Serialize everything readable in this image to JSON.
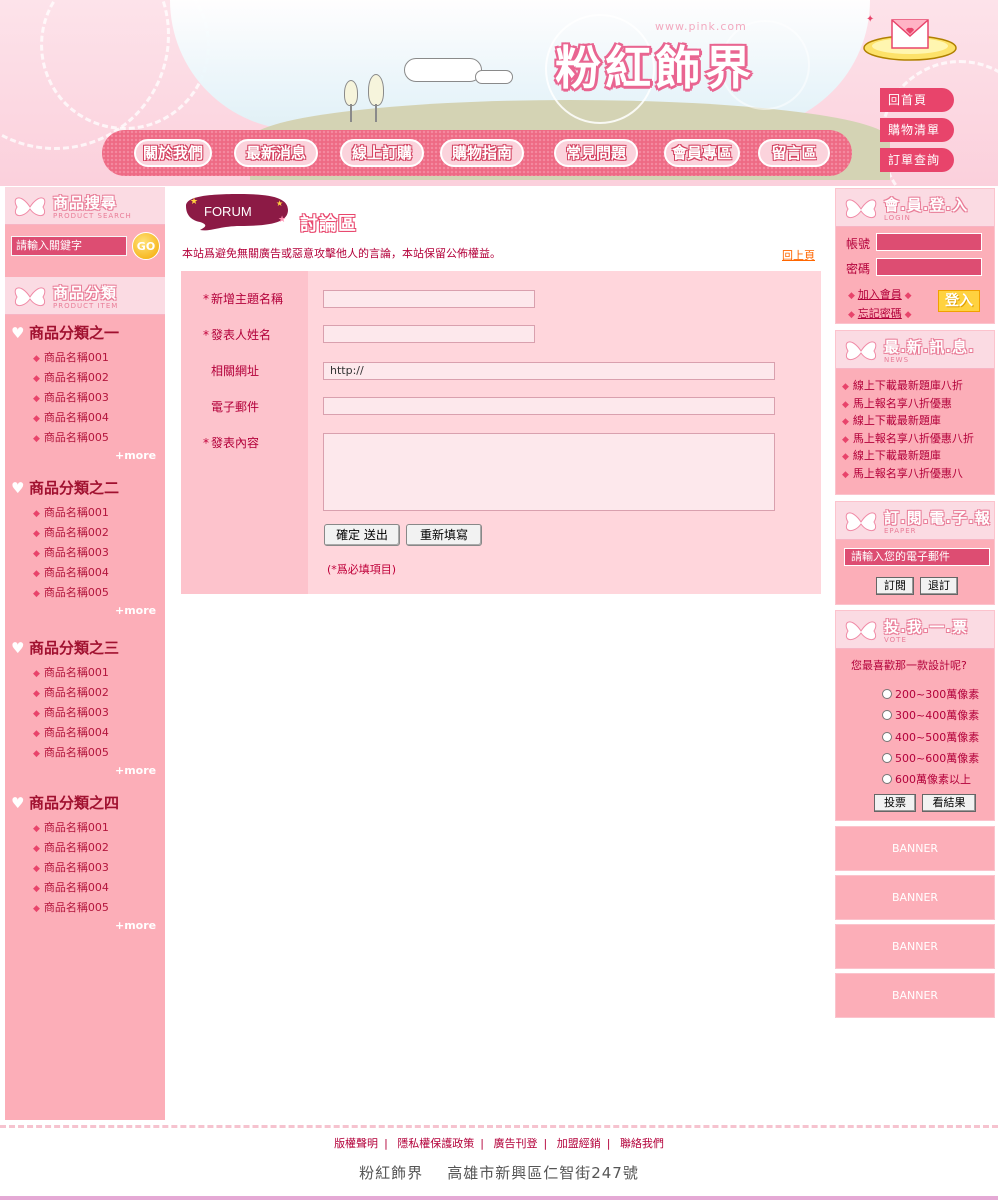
{
  "header": {
    "site_url": "www.pink.com",
    "site_name": "粉紅飾界",
    "nav": [
      "關於我們",
      "最新消息",
      "線上訂購",
      "購物指南",
      "常見問題",
      "會員專區",
      "留言區"
    ],
    "side_links": [
      "回首頁",
      "購物清單",
      "訂單查詢"
    ]
  },
  "left": {
    "search": {
      "title": "商品搜尋",
      "subtitle": "PRODUCT SEARCH",
      "placeholder": "請輸入關鍵字",
      "go": "GO"
    },
    "categories": {
      "title": "商品分類",
      "subtitle": "PRODUCT ITEM",
      "more": "+more",
      "groups": [
        {
          "name": "商品分類之一",
          "items": [
            "商品名稱001",
            "商品名稱002",
            "商品名稱003",
            "商品名稱004",
            "商品名稱005"
          ]
        },
        {
          "name": "商品分類之二",
          "items": [
            "商品名稱001",
            "商品名稱002",
            "商品名稱003",
            "商品名稱004",
            "商品名稱005"
          ]
        },
        {
          "name": "商品分類之三",
          "items": [
            "商品名稱001",
            "商品名稱002",
            "商品名稱003",
            "商品名稱004",
            "商品名稱005"
          ]
        },
        {
          "name": "商品分類之四",
          "items": [
            "商品名稱001",
            "商品名稱002",
            "商品名稱003",
            "商品名稱004",
            "商品名稱005"
          ]
        }
      ]
    }
  },
  "main": {
    "badge": "FORUM",
    "title": "討論區",
    "notice": "本站爲避免無關廣告或惡意攻擊他人的言論，本站保留公佈權益。",
    "back": "回上頁",
    "form": {
      "fields": [
        {
          "label": "新增主題名稱",
          "required": "*",
          "value": ""
        },
        {
          "label": "發表人姓名",
          "required": "*",
          "value": ""
        },
        {
          "label": "相關網址",
          "required": "",
          "value": "http://"
        },
        {
          "label": "電子郵件",
          "required": "",
          "value": ""
        },
        {
          "label": "發表內容",
          "required": "*",
          "value": ""
        }
      ],
      "submit": "確定 送出",
      "reset": "重新填寫",
      "required_note": "(*爲必填項目)"
    }
  },
  "right": {
    "login": {
      "title": "會.員.登.入",
      "subtitle": "LOGIN",
      "account": "帳號",
      "password": "密碼",
      "join": "加入會員",
      "forgot": "忘記密碼",
      "submit": "登入"
    },
    "news": {
      "title": "最.新.訊.息.",
      "subtitle": "NEWS",
      "items": [
        "線上下載最新題庫八折",
        "馬上報名享八折優惠",
        "線上下載最新題庫",
        "馬上報名享八折優惠八折",
        "線上下載最新題庫",
        "馬上報名享八折優惠八"
      ]
    },
    "epaper": {
      "title": "訂.閱.電.子.報",
      "subtitle": "EPAPER",
      "placeholder": "請輸入您的電子郵件",
      "subscribe": "訂閱",
      "unsubscribe": "退訂"
    },
    "vote": {
      "title": "投.我.一.票",
      "subtitle": "VOTE",
      "question": "您最喜歡那一款設計呢?",
      "options": [
        "200~300萬像素",
        "300~400萬像素",
        "400~500萬像素",
        "500~600萬像素",
        "600萬像素以上"
      ],
      "vote": "投票",
      "results": "看結果"
    },
    "banners": [
      "BANNER",
      "BANNER",
      "BANNER",
      "BANNER"
    ]
  },
  "footer": {
    "links": [
      "版權聲明",
      "隱私權保護政策",
      "廣告刊登",
      "加盟經銷",
      "聯絡我們"
    ],
    "company": "粉紅飾界",
    "address": "高雄市新興區仁智街247號"
  },
  "colors": {
    "accent": "#e8446b",
    "panel": "#fcaeb8",
    "form_bg": "#ffd6dc",
    "text": "#b3003a"
  }
}
